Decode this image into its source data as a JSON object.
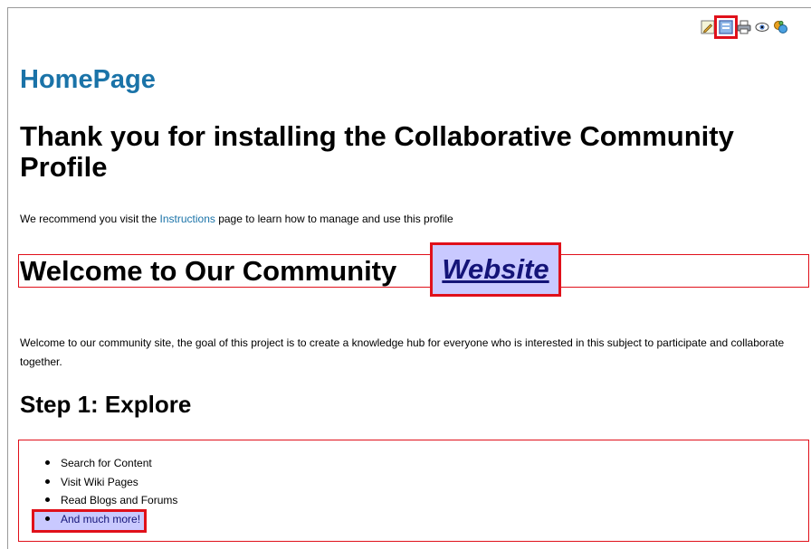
{
  "page": {
    "title": "HomePage",
    "hero_heading": "Thank you for installing the Collaborative Community Profile",
    "intro": {
      "before": "We recommend you visit the ",
      "link": "Instructions",
      "after": " page to learn how to manage and use this profile"
    },
    "welcome": {
      "text": "Welcome to Our Community",
      "link": "Website"
    },
    "body_text": "Welcome to our community site, the goal of this project is to create a knowledge hub for everyone who is interested in this subject to participate and collaborate together.",
    "step_heading": "Step 1: Explore",
    "list_items": [
      "Search for Content",
      "Visit Wiki Pages",
      "Read Blogs and Forums",
      "And much more!"
    ]
  },
  "toolbar": {
    "icons": [
      "edit-icon",
      "page-properties-icon",
      "print-icon",
      "preview-icon",
      "translate-icon"
    ],
    "selected": "page-properties-icon"
  },
  "colors": {
    "title_blue": "#1a73a8",
    "highlight_bg": "#c9c9ff",
    "highlight_border": "#e0101a",
    "link_dark": "#141478"
  }
}
